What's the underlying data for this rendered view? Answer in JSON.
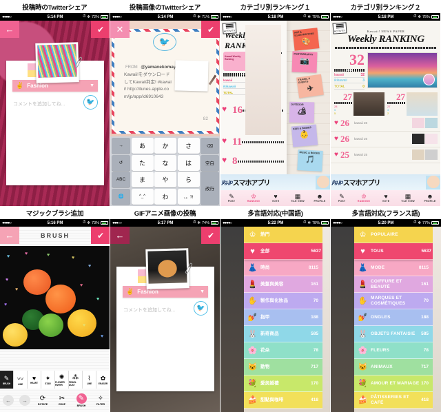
{
  "panels": [
    {
      "caption": "投稿時のTwitterシェア",
      "status": {
        "dots": "●●●●○",
        "carrier": "",
        "time": "5:14 PM",
        "battery": "72%"
      },
      "topbar": {
        "left_icon": "←",
        "right_icon": "✔"
      },
      "category": {
        "label": "Fashion",
        "icon": "hand-icon",
        "arrow": "▼"
      },
      "comment_placeholder": "コメントを追加してね...",
      "twitter_badge": "twitter-bird-icon"
    },
    {
      "caption": "投稿画像のTwitterシェア",
      "status": {
        "dots": "●●●●○",
        "time": "5:14 PM",
        "battery": "71%"
      },
      "topbar": {
        "left_icon": "✕",
        "right_icon": "✔"
      },
      "from_label": "FROM",
      "from_handle": "@yamanekomay",
      "tweet_text": "Kawaii!をダウンロードしてKawaii判定! #kawaii! http://itunes.apple.com/jp/app/id6910643",
      "char_count": "82",
      "keyboard": {
        "rows": [
          [
            "→",
            "あ",
            "か",
            "さ",
            "⌫"
          ],
          [
            "↺",
            "た",
            "な",
            "は",
            "空白"
          ],
          [
            "ABC",
            "ま",
            "や",
            "ら",
            "改行"
          ],
          [
            "🌐",
            "^_^",
            "わ",
            "、。?!",
            ""
          ]
        ],
        "mic": "🎤"
      }
    },
    {
      "caption": "カテゴリ別ランキング１",
      "status": {
        "dots": "●●●●○",
        "time": "5:18 PM",
        "battery": "75%"
      },
      "menu_button": "ACTIVITY",
      "page_title": "Weekly RANKING",
      "badge": "Kawaii Weekly Ranking",
      "stat_labels": {
        "header": "DATA",
        "kawaii": "kawaii",
        "ikikawaii": "ikikawaii",
        "total": "TOTAL"
      },
      "ranks": [
        {
          "num": "16",
          "kawaii": "16",
          "ikikawaii": "3",
          "total": "0"
        },
        {
          "num": "11",
          "kawaii": "kawaii 11"
        },
        {
          "num": "8",
          "kawaii": "kawaii 8"
        }
      ],
      "stickies": [
        {
          "label": "ART & ILLUSTRATIONS",
          "glyph": "🎨",
          "color": "#f4664f"
        },
        {
          "label": "PHOTOGRAPHY",
          "glyph": "📷",
          "color": "#f789b4"
        },
        {
          "label": "TRAVEL & EVENTS",
          "glyph": "✈",
          "color": "#f7b6a0"
        },
        {
          "label": "OUTDOOR",
          "glyph": "🏕",
          "color": "#d8b4e8"
        },
        {
          "label": "KIDS & BABIES",
          "glyph": "👶",
          "color": "#c5b8ea"
        },
        {
          "label": "MUSIC & BOOKS",
          "glyph": "🎵",
          "color": "#a9d9ef"
        }
      ],
      "banner": {
        "brand": "jig.jp",
        "text": "スマホアプリ"
      },
      "nav": [
        {
          "label": "POST",
          "glyph": "✎",
          "active": false
        },
        {
          "label": "RANKING",
          "glyph": "♔",
          "active": true
        },
        {
          "label": "VOTE",
          "glyph": "♥",
          "active": false
        },
        {
          "label": "TILE VIEW",
          "glyph": "▦",
          "active": false
        },
        {
          "label": "PROFILE",
          "glyph": "☻",
          "active": false
        }
      ]
    },
    {
      "caption": "カテゴリ別ランキング２",
      "status": {
        "dots": "●●●●○",
        "time": "5:18 PM",
        "battery": "75%"
      },
      "menu_button": "ACTIVITY",
      "masthead": "Kawaii! NEWS PAPER",
      "page_title": "Weekly RANKING",
      "data_header": "DATA",
      "top_entry": {
        "rank": "32",
        "kawaii_label": "kawaii",
        "kawaii": "32",
        "ikikawaii_label": "ikikawaii",
        "ikikawaii": "3",
        "total_label": "TOTAL",
        "total": "0"
      },
      "second_row": [
        {
          "rank": "27",
          "kawaii": "28",
          "ikikawaii": "5",
          "total": "5"
        },
        {
          "rank": "27",
          "kawaii": "27",
          "ikikawaii": "3",
          "total": "2"
        }
      ],
      "list": [
        {
          "rank": "26",
          "kawaii": "kawaii 26",
          "ikikawaii": "ikikawaii 3",
          "total": "TOTAL 1"
        },
        {
          "rank": "26",
          "kawaii": "kawaii 26",
          "ikikawaii": "ikikawaii 1",
          "total": "TOTAL 0"
        },
        {
          "rank": "25",
          "kawaii": "kawaii 25",
          "ikikawaii": "ikikawaii 2",
          "total": "TOTAL 1"
        }
      ],
      "banner": {
        "brand": "jig.jp",
        "text": "スマホアプリ"
      },
      "nav": [
        {
          "label": "POST",
          "glyph": "✎",
          "active": false
        },
        {
          "label": "RANKING",
          "glyph": "♔",
          "active": true
        },
        {
          "label": "VOTE",
          "glyph": "♥",
          "active": false
        },
        {
          "label": "TILE VIEW",
          "glyph": "▦",
          "active": false
        },
        {
          "label": "PROFILE",
          "glyph": "☻",
          "active": false
        }
      ]
    },
    {
      "caption": "マジックブラシ追加",
      "status": {
        "dots": "●●●●○",
        "time": "5:16 PM",
        "battery": "73%"
      },
      "topbar": {
        "left_icon": "←",
        "right_icon": "✔",
        "title": "BRUSH"
      },
      "brushes": [
        {
          "label": "BRUSH",
          "glyph": "✎",
          "active": true
        },
        {
          "label": "LINE",
          "glyph": "〰",
          "active": false
        },
        {
          "label": "HEART",
          "glyph": "♥",
          "active": false
        },
        {
          "label": "STAR",
          "glyph": "✦",
          "active": false
        },
        {
          "label": "FLOWER PAPER",
          "glyph": "✺",
          "active": false
        },
        {
          "label": "PEARL DUST",
          "glyph": "⁂",
          "active": false
        },
        {
          "label": "LINE",
          "glyph": "⌇",
          "active": false
        },
        {
          "label": "ERASER",
          "glyph": "✿",
          "active": false
        }
      ],
      "tools": [
        {
          "label": "ROTATE",
          "glyph": "⟳",
          "active": false
        },
        {
          "label": "CROP",
          "glyph": "✂",
          "active": false
        },
        {
          "label": "BRUSH",
          "glyph": "✎",
          "active": true
        },
        {
          "label": "FILTER",
          "glyph": "✧",
          "active": false
        }
      ],
      "nav_prev": "←",
      "nav_next": "→"
    },
    {
      "caption": "GIFアニメ画像の投稿",
      "status": {
        "dots": "●●●○○",
        "time": "5:17 PM",
        "battery": "74%"
      },
      "topbar": {
        "left_icon": "←",
        "right_icon": "✔"
      },
      "category": {
        "label": "Fashion",
        "icon": "hand-icon",
        "arrow": "▼"
      },
      "comment_placeholder": "コメントを追加してね...",
      "twitter_badge": "twitter-bird-icon"
    },
    {
      "caption": "多言語対応(中国語)",
      "status": {
        "dots": "●●●●○",
        "time": "5:22 PM",
        "battery": "78%"
      },
      "header": {
        "label": "熱門",
        "glyph": "♔",
        "color": "#f5d44e"
      },
      "categories": [
        {
          "label": "全部",
          "count": "5637",
          "glyph": "♥",
          "color": "#ef476f",
          "selected": true
        },
        {
          "label": "時尚",
          "count": "8115",
          "glyph": "👗",
          "color": "#f7a8c4",
          "selected": false
        },
        {
          "label": "美髮與美容",
          "count": "161",
          "glyph": "💄",
          "color": "#e0a8e0",
          "selected": false
        },
        {
          "label": "製作與化妝品",
          "count": "70",
          "glyph": "✋",
          "color": "#bdaaf0",
          "selected": false
        },
        {
          "label": "指甲",
          "count": "188",
          "glyph": "💅",
          "color": "#a8bff0",
          "selected": false
        },
        {
          "label": "新奇商品",
          "count": "585",
          "glyph": "🐰",
          "color": "#8fd8e8",
          "selected": false
        },
        {
          "label": "花朵",
          "count": "78",
          "glyph": "🌸",
          "color": "#8fe0c8",
          "selected": false
        },
        {
          "label": "動物",
          "count": "717",
          "glyph": "🐱",
          "color": "#9fe0a0",
          "selected": false
        },
        {
          "label": "愛與婚禮",
          "count": "170",
          "glyph": "💐",
          "color": "#c8e86a",
          "selected": false
        },
        {
          "label": "甜點與咖啡",
          "count": "418",
          "glyph": "🍰",
          "color": "#f2e05a",
          "selected": false
        }
      ]
    },
    {
      "caption": "多言語対応(フランス語)",
      "status": {
        "dots": "●●●●○",
        "time": "5:20 PM",
        "battery": "77%"
      },
      "header": {
        "label": "POPULAIRE",
        "glyph": "♔",
        "color": "#f5d44e"
      },
      "categories": [
        {
          "label": "TOUS",
          "count": "5637",
          "glyph": "♥",
          "color": "#ef476f",
          "selected": true
        },
        {
          "label": "MODE",
          "count": "8115",
          "glyph": "👗",
          "color": "#f7a8c4",
          "selected": false
        },
        {
          "label": "COIFFURE ET BEAUTÉ",
          "count": "161",
          "glyph": "💄",
          "color": "#e0a8e0",
          "selected": false
        },
        {
          "label": "MARQUES ET COSMÉTIQUES",
          "count": "70",
          "glyph": "✋",
          "color": "#bdaaf0",
          "selected": false
        },
        {
          "label": "ONGLES",
          "count": "188",
          "glyph": "💅",
          "color": "#a8bff0",
          "selected": false
        },
        {
          "label": "OBJETS FANTAISIE",
          "count": "585",
          "glyph": "🐰",
          "color": "#8fd8e8",
          "selected": false
        },
        {
          "label": "FLEURS",
          "count": "78",
          "glyph": "🌸",
          "color": "#8fe0c8",
          "selected": false
        },
        {
          "label": "ANIMAUX",
          "count": "717",
          "glyph": "🐱",
          "color": "#9fe0a0",
          "selected": false
        },
        {
          "label": "AMOUR ET MARIAGE",
          "count": "170",
          "glyph": "💐",
          "color": "#c8e86a",
          "selected": false
        },
        {
          "label": "PÂTISSERIES ET CAFÉ",
          "count": "418",
          "glyph": "🍰",
          "color": "#f2e05a",
          "selected": false
        }
      ]
    }
  ]
}
